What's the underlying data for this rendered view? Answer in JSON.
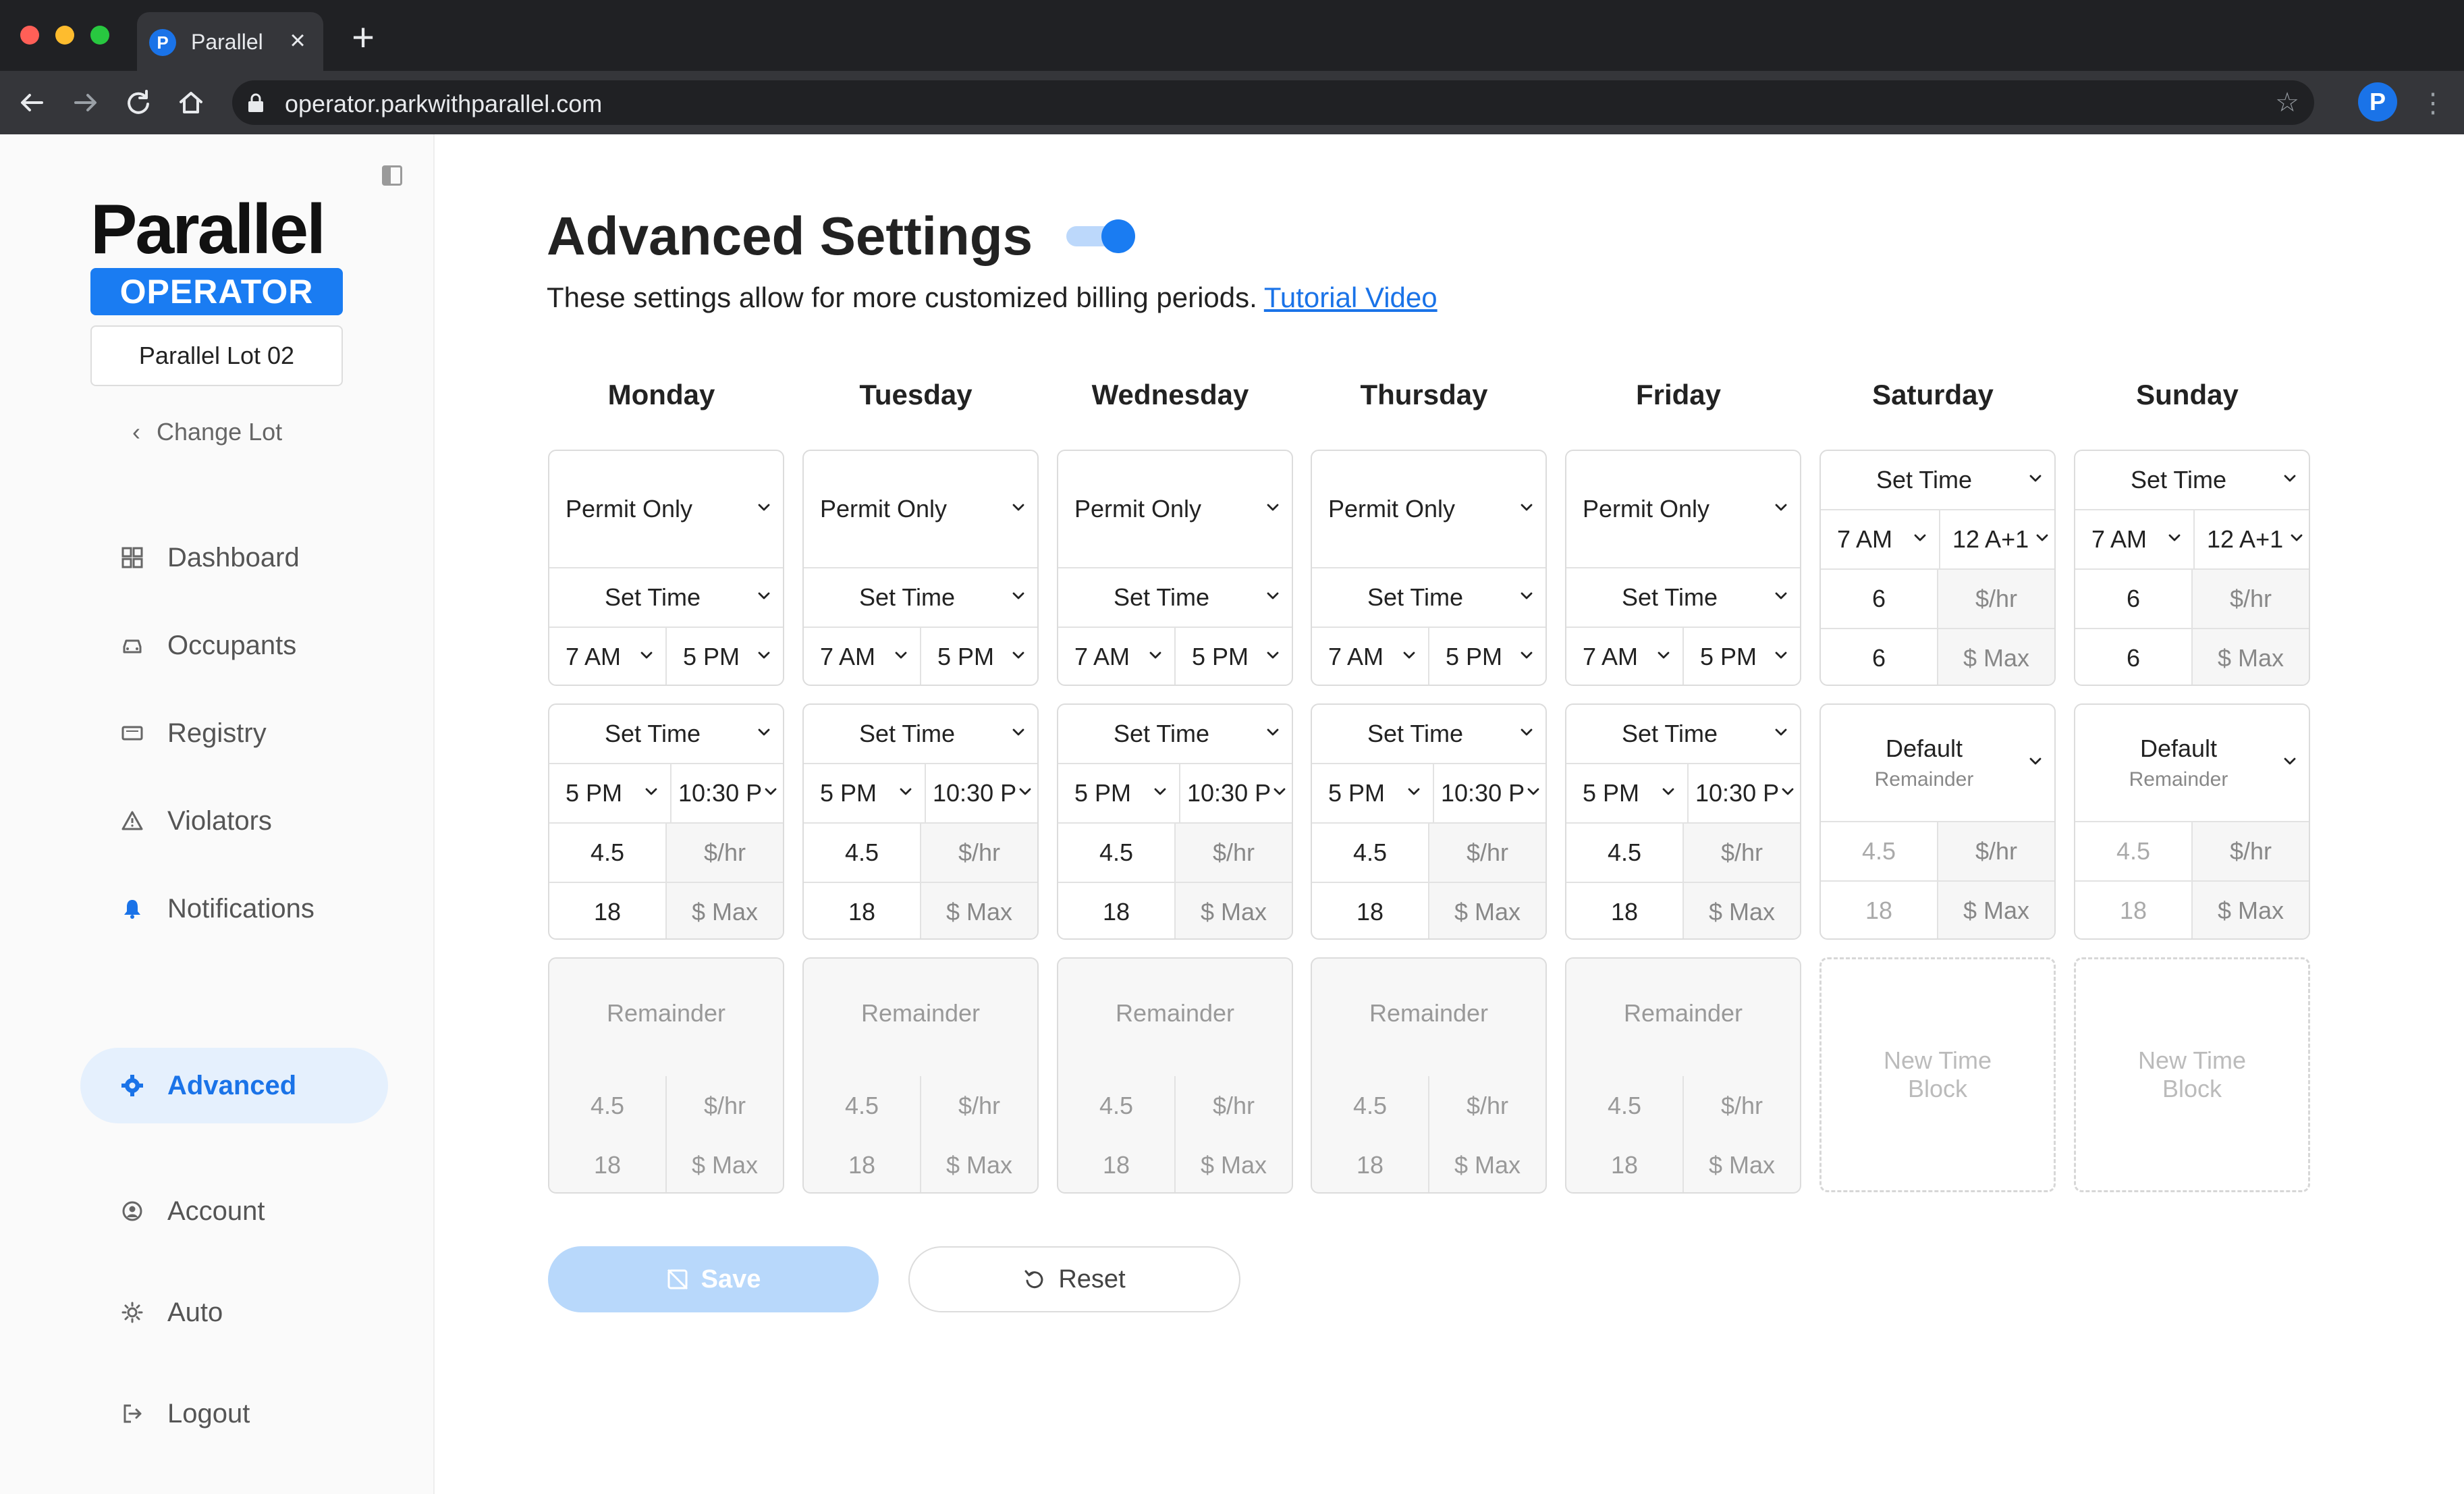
{
  "browser": {
    "tab_title": "Parallel",
    "favicon_letter": "P",
    "tab_close": "×",
    "new_tab": "+",
    "url": "operator.parkwithparallel.com",
    "profile_letter": "P"
  },
  "sidebar": {
    "logo": "Parallel",
    "badge": "OPERATOR",
    "lot": "Parallel Lot 02",
    "change_lot": "Change Lot",
    "items": [
      {
        "label": "Dashboard",
        "icon": "dashboard-icon"
      },
      {
        "label": "Occupants",
        "icon": "car-icon"
      },
      {
        "label": "Registry",
        "icon": "registry-icon"
      },
      {
        "label": "Violators",
        "icon": "warning-icon"
      },
      {
        "label": "Notifications",
        "icon": "bell-icon"
      },
      {
        "label": "Advanced",
        "icon": "gear-icon",
        "active": true
      },
      {
        "label": "Account",
        "icon": "user-icon"
      },
      {
        "label": "Auto",
        "icon": "sun-icon"
      },
      {
        "label": "Logout",
        "icon": "logout-icon"
      }
    ]
  },
  "main": {
    "title": "Advanced Settings",
    "toggle_on": true,
    "subtitle": "These settings allow for more customized billing periods.",
    "tutorial_link": "Tutorial Video",
    "accent": "#1a7cf2",
    "days": [
      "Monday",
      "Tuesday",
      "Wednesday",
      "Thursday",
      "Friday",
      "Saturday",
      "Sunday"
    ],
    "weekday": {
      "block1": {
        "mode": "Permit Only",
        "type": "Set Time",
        "start": "7 AM",
        "end": "5 PM"
      },
      "block2": {
        "type": "Set Time",
        "start": "5 PM",
        "end": "10:30 P",
        "rate": "4.5",
        "rate_unit": "$/hr",
        "max": "18",
        "max_unit": "$ Max"
      },
      "block3": {
        "type": "Remainder",
        "rate": "4.5",
        "rate_unit": "$/hr",
        "max": "18",
        "max_unit": "$ Max"
      }
    },
    "weekend": {
      "block1": {
        "type": "Set Time",
        "start": "7 AM",
        "end": "12 A+1",
        "rate": "6",
        "rate_unit": "$/hr",
        "max": "6",
        "max_unit": "$ Max"
      },
      "block2": {
        "type": "Default",
        "sub": "Remainder",
        "rate": "4.5",
        "rate_unit": "$/hr",
        "max": "18",
        "max_unit": "$ Max"
      },
      "block3": {
        "label_line1": "New Time",
        "label_line2": "Block"
      }
    },
    "save": "Save",
    "reset": "Reset"
  }
}
